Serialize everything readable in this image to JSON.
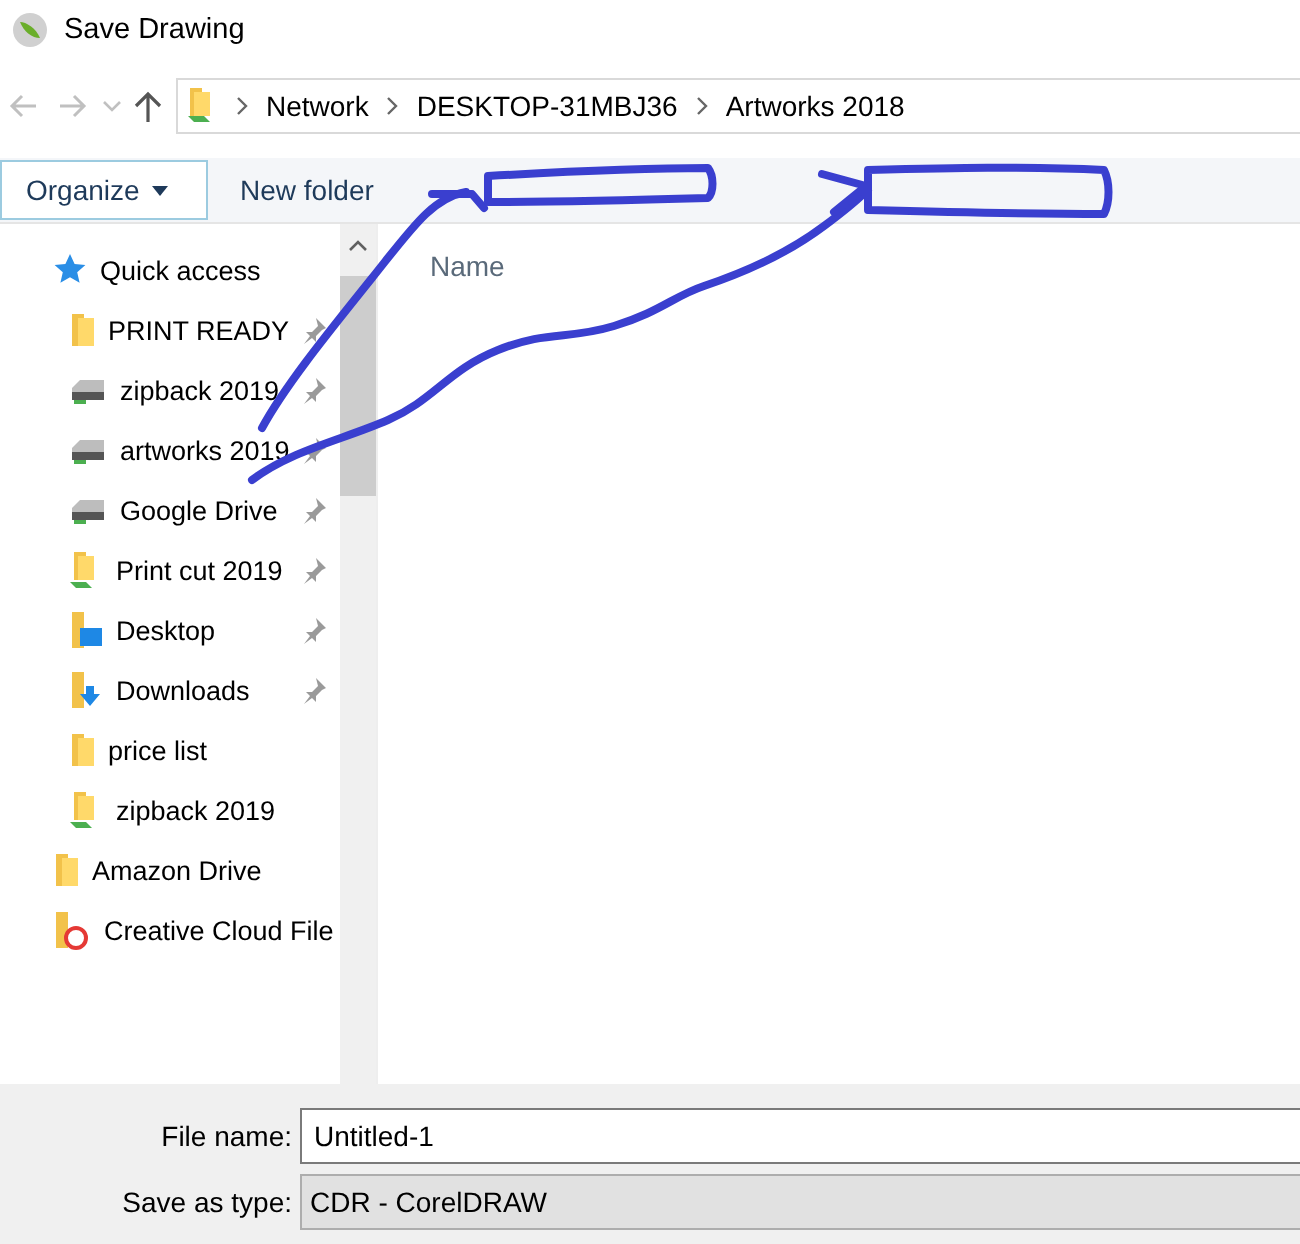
{
  "window": {
    "title": "Save Drawing"
  },
  "address_bar": {
    "crumbs": [
      "Network",
      "DESKTOP-31MBJ36",
      "Artworks 2018"
    ]
  },
  "toolbar": {
    "organize": "Organize",
    "new_folder": "New folder"
  },
  "sidebar": {
    "items": [
      {
        "label": "Quick access",
        "kind": "star",
        "pinned": false,
        "children": [
          {
            "label": "PRINT READY",
            "kind": "folder",
            "pinned": true
          },
          {
            "label": "zipback 2019",
            "kind": "drive",
            "pinned": true
          },
          {
            "label": "artworks 2019",
            "kind": "drive",
            "pinned": true
          },
          {
            "label": "Google Drive",
            "kind": "drive",
            "pinned": true
          },
          {
            "label": "Print cut 2019",
            "kind": "synced",
            "pinned": true
          },
          {
            "label": "Desktop",
            "kind": "desktop",
            "pinned": true
          },
          {
            "label": "Downloads",
            "kind": "downloads",
            "pinned": true
          },
          {
            "label": "price list",
            "kind": "folder",
            "pinned": false
          },
          {
            "label": "zipback 2019",
            "kind": "synced",
            "pinned": false
          }
        ]
      },
      {
        "label": "Amazon Drive",
        "kind": "folder",
        "pinned": false
      },
      {
        "label": "Creative Cloud File",
        "kind": "cloud",
        "pinned": false
      }
    ]
  },
  "file_list": {
    "columns": [
      "Name"
    ]
  },
  "form": {
    "file_name_label": "File name:",
    "file_name": "Untitled-1",
    "type_label": "Save as type:",
    "type": "CDR - CorelDRAW"
  }
}
